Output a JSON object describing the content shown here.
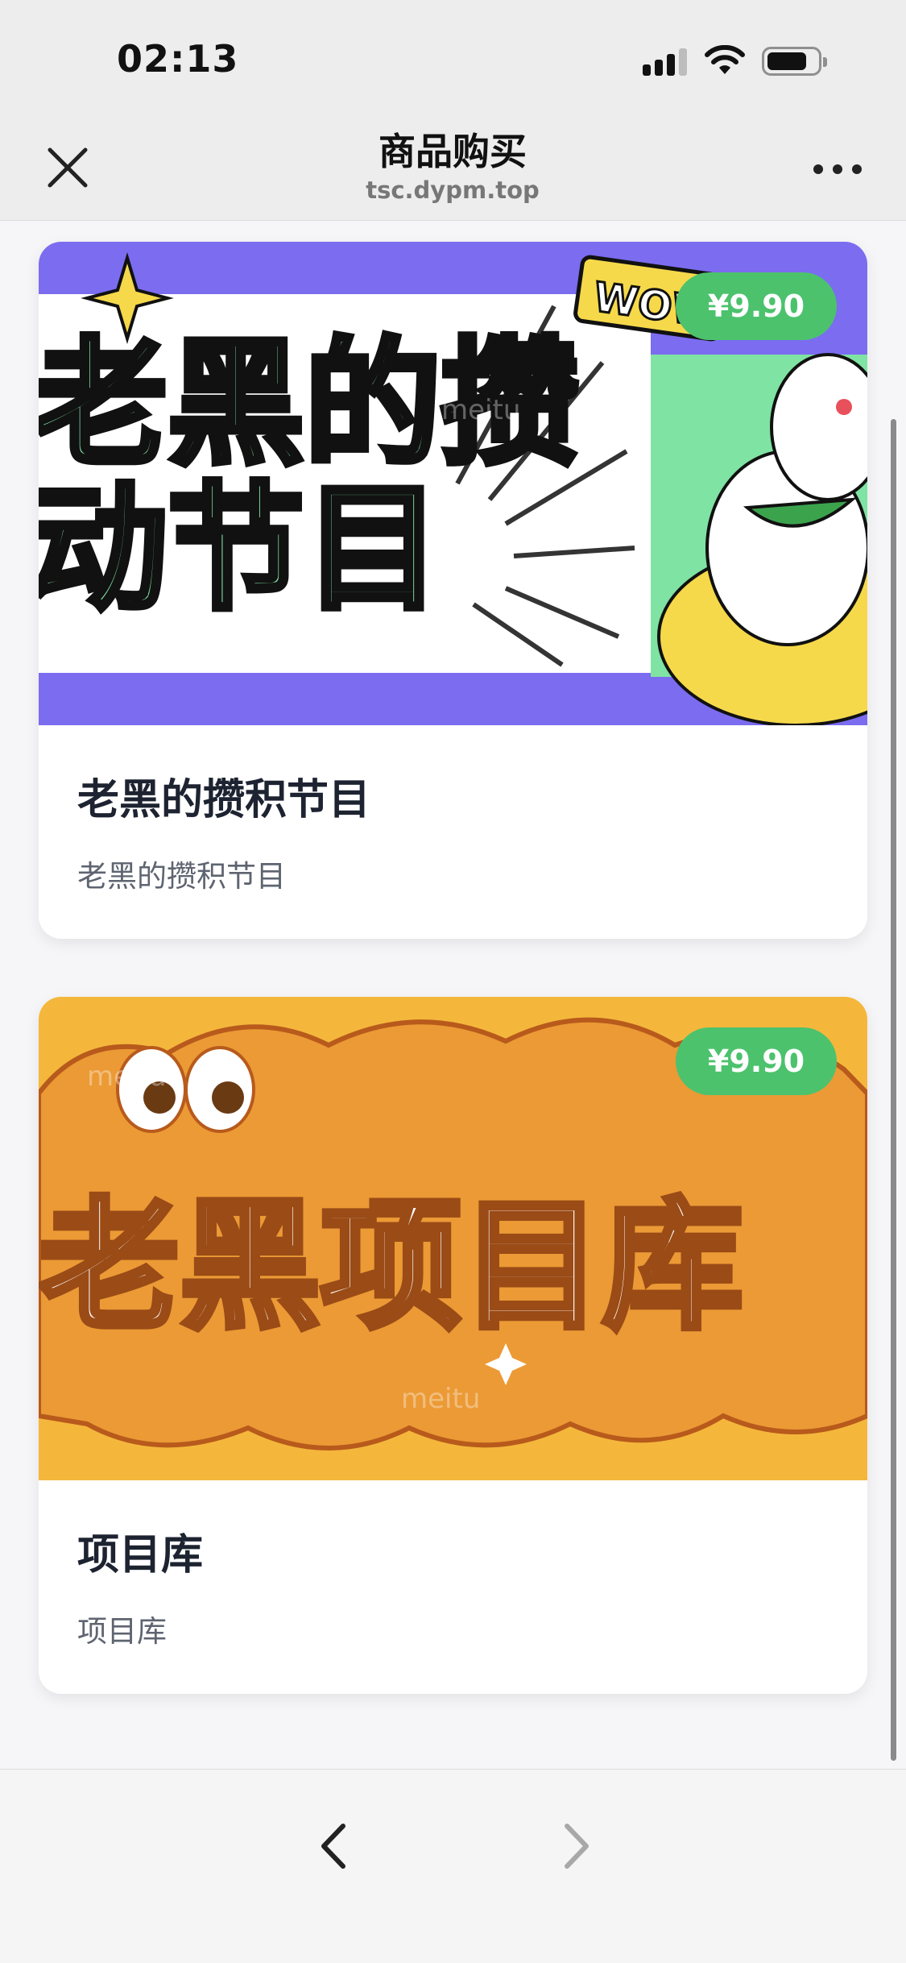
{
  "status": {
    "time": "02:13"
  },
  "nav": {
    "title": "商品购买",
    "subtitle": "tsc.dypm.top"
  },
  "products": [
    {
      "title": "老黑的攒积节目",
      "description": "老黑的攒积节目",
      "price": "¥9.90",
      "banner_text_1": "老黑的攒",
      "banner_text_2": "动节目",
      "banner_wow": "WOW",
      "banner_watermark": "meitu"
    },
    {
      "title": "项目库",
      "description": "项目库",
      "price": "¥9.90",
      "banner_text": "老黑项目库",
      "banner_watermark": "meitu"
    }
  ],
  "colors": {
    "price_badge": "#4cc26d",
    "banner1_bg": "#7b6cf0",
    "banner2_bg": "#f4b73c"
  }
}
